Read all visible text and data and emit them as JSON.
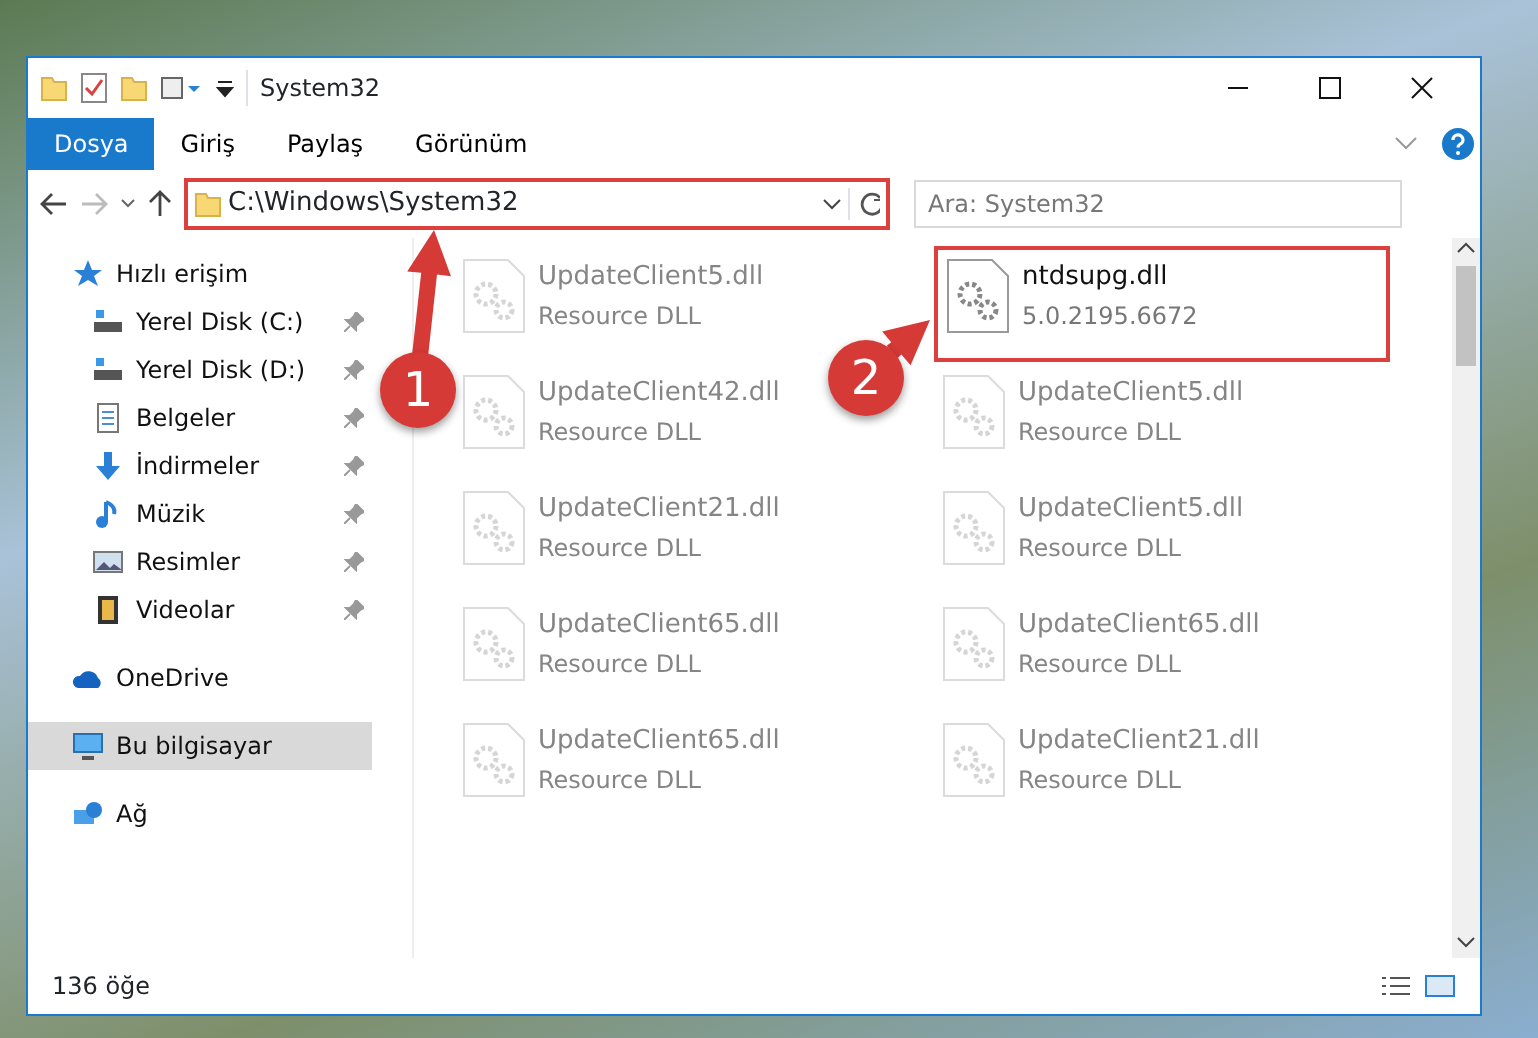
{
  "window": {
    "title": "System32"
  },
  "ribbon_tabs": [
    {
      "label": "Dosya",
      "kind": "file"
    },
    {
      "label": "Giriş",
      "kind": "tab"
    },
    {
      "label": "Paylaş",
      "kind": "tab"
    },
    {
      "label": "Görünüm",
      "kind": "tab"
    }
  ],
  "address": {
    "path": "C:\\Windows\\System32",
    "highlighted": true
  },
  "search": {
    "placeholder": "Ara: System32"
  },
  "navigation": [
    {
      "label": "Hızlı erişim",
      "selected": false,
      "children": [
        {
          "label": "Yerel Disk (C:)",
          "pinned": true,
          "selected": false
        },
        {
          "label": "Yerel Disk (D:)",
          "pinned": true,
          "selected": false
        },
        {
          "label": "Belgeler",
          "pinned": true,
          "selected": false
        },
        {
          "label": "İndirmeler",
          "pinned": true,
          "selected": false
        },
        {
          "label": "Müzik",
          "pinned": true,
          "selected": false
        },
        {
          "label": "Resimler",
          "pinned": true,
          "selected": false
        },
        {
          "label": "Videolar",
          "pinned": true,
          "selected": false
        }
      ]
    },
    {
      "label": "OneDrive",
      "selected": false
    },
    {
      "label": "Bu bilgisayar",
      "selected": true
    },
    {
      "label": "Ağ",
      "selected": false
    }
  ],
  "files": [
    {
      "name": "UpdateClient5.dll",
      "detail": "Resource DLL",
      "faded": true,
      "highlighted": false
    },
    {
      "name": "ntdsupg.dll",
      "detail": "5.0.2195.6672",
      "faded": false,
      "highlighted": true
    },
    {
      "name": "UpdateClient42.dll",
      "detail": "Resource DLL",
      "faded": true,
      "highlighted": false
    },
    {
      "name": "UpdateClient5.dll",
      "detail": "Resource DLL",
      "faded": true,
      "highlighted": false
    },
    {
      "name": "UpdateClient21.dll",
      "detail": "Resource DLL",
      "faded": true,
      "highlighted": false
    },
    {
      "name": "UpdateClient5.dll",
      "detail": "Resource DLL",
      "faded": true,
      "highlighted": false
    },
    {
      "name": "UpdateClient65.dll",
      "detail": "Resource DLL",
      "faded": true,
      "highlighted": false
    },
    {
      "name": "UpdateClient65.dll",
      "detail": "Resource DLL",
      "faded": true,
      "highlighted": false
    },
    {
      "name": "UpdateClient65.dll",
      "detail": "Resource DLL",
      "faded": true,
      "highlighted": false
    },
    {
      "name": "UpdateClient21.dll",
      "detail": "Resource DLL",
      "faded": true,
      "highlighted": false
    }
  ],
  "status_bar": {
    "item_count": "136 öğe"
  },
  "callouts": [
    {
      "number": "1"
    },
    {
      "number": "2"
    }
  ]
}
